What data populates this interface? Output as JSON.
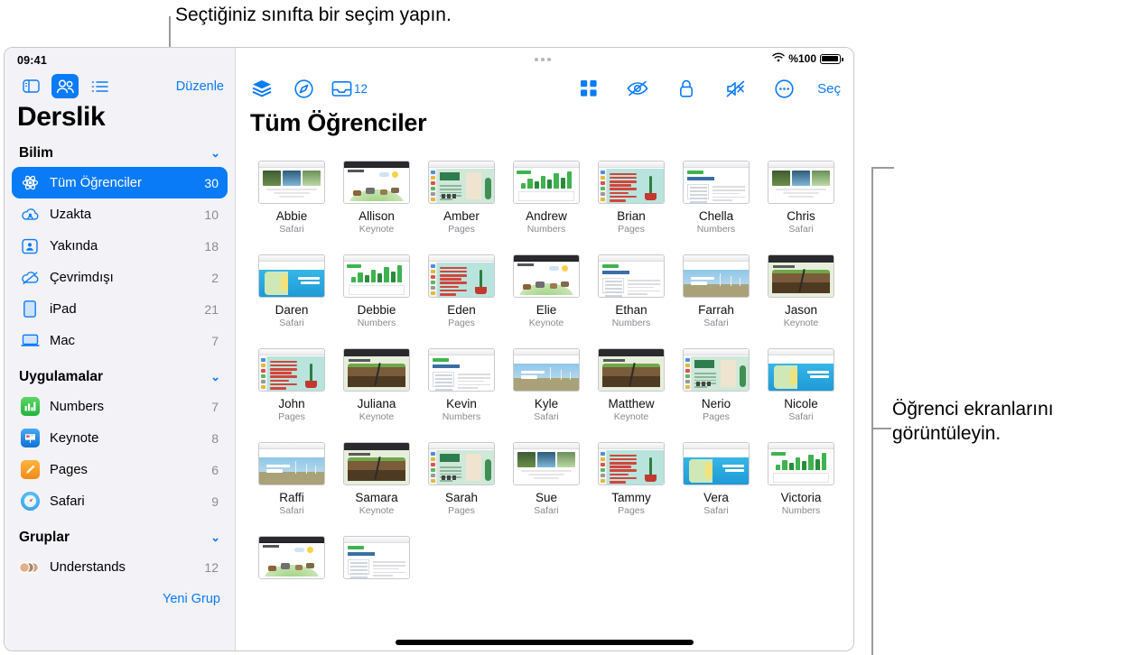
{
  "callouts": {
    "top": "Seçtiğiniz sınıfta bir seçim yapın.",
    "right": "Öğrenci ekranlarını görüntüleyin."
  },
  "status_bar": {
    "time": "09:41",
    "battery_label": "%100",
    "wifi_icon": "wifi-icon",
    "battery_icon": "battery-icon"
  },
  "sidebar": {
    "toolbar": {
      "sidebar_toggle_icon": "sidebar-toggle-icon",
      "people_icon": "people-icon",
      "list_icon": "list-icon",
      "edit_label": "Düzenle"
    },
    "title": "Derslik",
    "sections": [
      {
        "label": "Bilim",
        "chevron": "⌄",
        "items": [
          {
            "icon": "atom-icon",
            "label": "Tüm Öğrenciler",
            "count": "30",
            "selected": true
          },
          {
            "icon": "cloud-user-icon",
            "label": "Uzakta",
            "count": "10",
            "selected": false
          },
          {
            "icon": "person-frame-icon",
            "label": "Yakında",
            "count": "18",
            "selected": false
          },
          {
            "icon": "cloud-slash-icon",
            "label": "Çevrimdışı",
            "count": "2",
            "selected": false
          },
          {
            "icon": "ipad-icon",
            "label": "iPad",
            "count": "21",
            "selected": false
          },
          {
            "icon": "mac-icon",
            "label": "Mac",
            "count": "7",
            "selected": false
          }
        ]
      },
      {
        "label": "Uygulamalar",
        "chevron": "⌄",
        "items": [
          {
            "icon": "numbers-app-icon",
            "label": "Numbers",
            "count": "7",
            "selected": false
          },
          {
            "icon": "keynote-app-icon",
            "label": "Keynote",
            "count": "8",
            "selected": false
          },
          {
            "icon": "pages-app-icon",
            "label": "Pages",
            "count": "6",
            "selected": false
          },
          {
            "icon": "safari-app-icon",
            "label": "Safari",
            "count": "9",
            "selected": false
          }
        ]
      },
      {
        "label": "Gruplar",
        "chevron": "⌄",
        "items": [
          {
            "icon": "group-avatars-icon",
            "label": "Understands",
            "count": "12",
            "selected": false
          }
        ]
      }
    ],
    "new_group_label": "Yeni Grup"
  },
  "main": {
    "toolbar_left": [
      {
        "icon": "layers-icon",
        "name": "layers-button",
        "badge": ""
      },
      {
        "icon": "compass-icon",
        "name": "navigate-button",
        "badge": ""
      },
      {
        "icon": "inbox-icon",
        "name": "inbox-button",
        "badge": "12"
      }
    ],
    "toolbar_right": [
      {
        "icon": "grid-icon",
        "name": "grid-view-button"
      },
      {
        "icon": "eye-slash-icon",
        "name": "hide-screen-button"
      },
      {
        "icon": "lock-icon",
        "name": "lock-button"
      },
      {
        "icon": "mute-icon",
        "name": "mute-button"
      },
      {
        "icon": "ellipsis-circle-icon",
        "name": "more-button"
      }
    ],
    "select_label": "Seç",
    "title": "Tüm Öğrenciler",
    "students": [
      {
        "name": "Abbie",
        "app": "Safari",
        "art": "safari-forest"
      },
      {
        "name": "Allison",
        "app": "Keynote",
        "art": "keynote-animals"
      },
      {
        "name": "Amber",
        "app": "Pages",
        "art": "pages-plants"
      },
      {
        "name": "Andrew",
        "app": "Numbers",
        "art": "numbers-chart"
      },
      {
        "name": "Brian",
        "app": "Pages",
        "art": "pages-cactus"
      },
      {
        "name": "Chella",
        "app": "Numbers",
        "art": "numbers-doc"
      },
      {
        "name": "Chris",
        "app": "Safari",
        "art": "safari-forest"
      },
      {
        "name": "Daren",
        "app": "Safari",
        "art": "safari-reef"
      },
      {
        "name": "Debbie",
        "app": "Numbers",
        "art": "numbers-chart"
      },
      {
        "name": "Eden",
        "app": "Pages",
        "art": "pages-cactus"
      },
      {
        "name": "Elie",
        "app": "Keynote",
        "art": "keynote-animals"
      },
      {
        "name": "Ethan",
        "app": "Numbers",
        "art": "numbers-doc"
      },
      {
        "name": "Farrah",
        "app": "Safari",
        "art": "safari-wind"
      },
      {
        "name": "Jason",
        "app": "Keynote",
        "art": "keynote-quake"
      },
      {
        "name": "John",
        "app": "Pages",
        "art": "pages-cactus"
      },
      {
        "name": "Juliana",
        "app": "Keynote",
        "art": "keynote-quake"
      },
      {
        "name": "Kevin",
        "app": "Numbers",
        "art": "numbers-doc"
      },
      {
        "name": "Kyle",
        "app": "Safari",
        "art": "safari-wind"
      },
      {
        "name": "Matthew",
        "app": "Keynote",
        "art": "keynote-quake"
      },
      {
        "name": "Nerio",
        "app": "Pages",
        "art": "pages-plants"
      },
      {
        "name": "Nicole",
        "app": "Safari",
        "art": "safari-reef"
      },
      {
        "name": "Raffi",
        "app": "Safari",
        "art": "safari-wind"
      },
      {
        "name": "Samara",
        "app": "Keynote",
        "art": "keynote-quake"
      },
      {
        "name": "Sarah",
        "app": "Pages",
        "art": "pages-plants"
      },
      {
        "name": "Sue",
        "app": "Safari",
        "art": "safari-forest"
      },
      {
        "name": "Tammy",
        "app": "Pages",
        "art": "pages-cactus"
      },
      {
        "name": "Vera",
        "app": "Safari",
        "art": "safari-reef"
      },
      {
        "name": "Victoria",
        "app": "Numbers",
        "art": "numbers-chart"
      },
      {
        "name": "",
        "app": "",
        "art": "keynote-animals"
      },
      {
        "name": "",
        "app": "",
        "art": "numbers-doc"
      }
    ]
  },
  "colors": {
    "accent": "#0a7bf7",
    "sidebar_bg": "#f2f2f7",
    "muted_text": "#8a8a8f",
    "leader_line": "#9a9a9a"
  }
}
